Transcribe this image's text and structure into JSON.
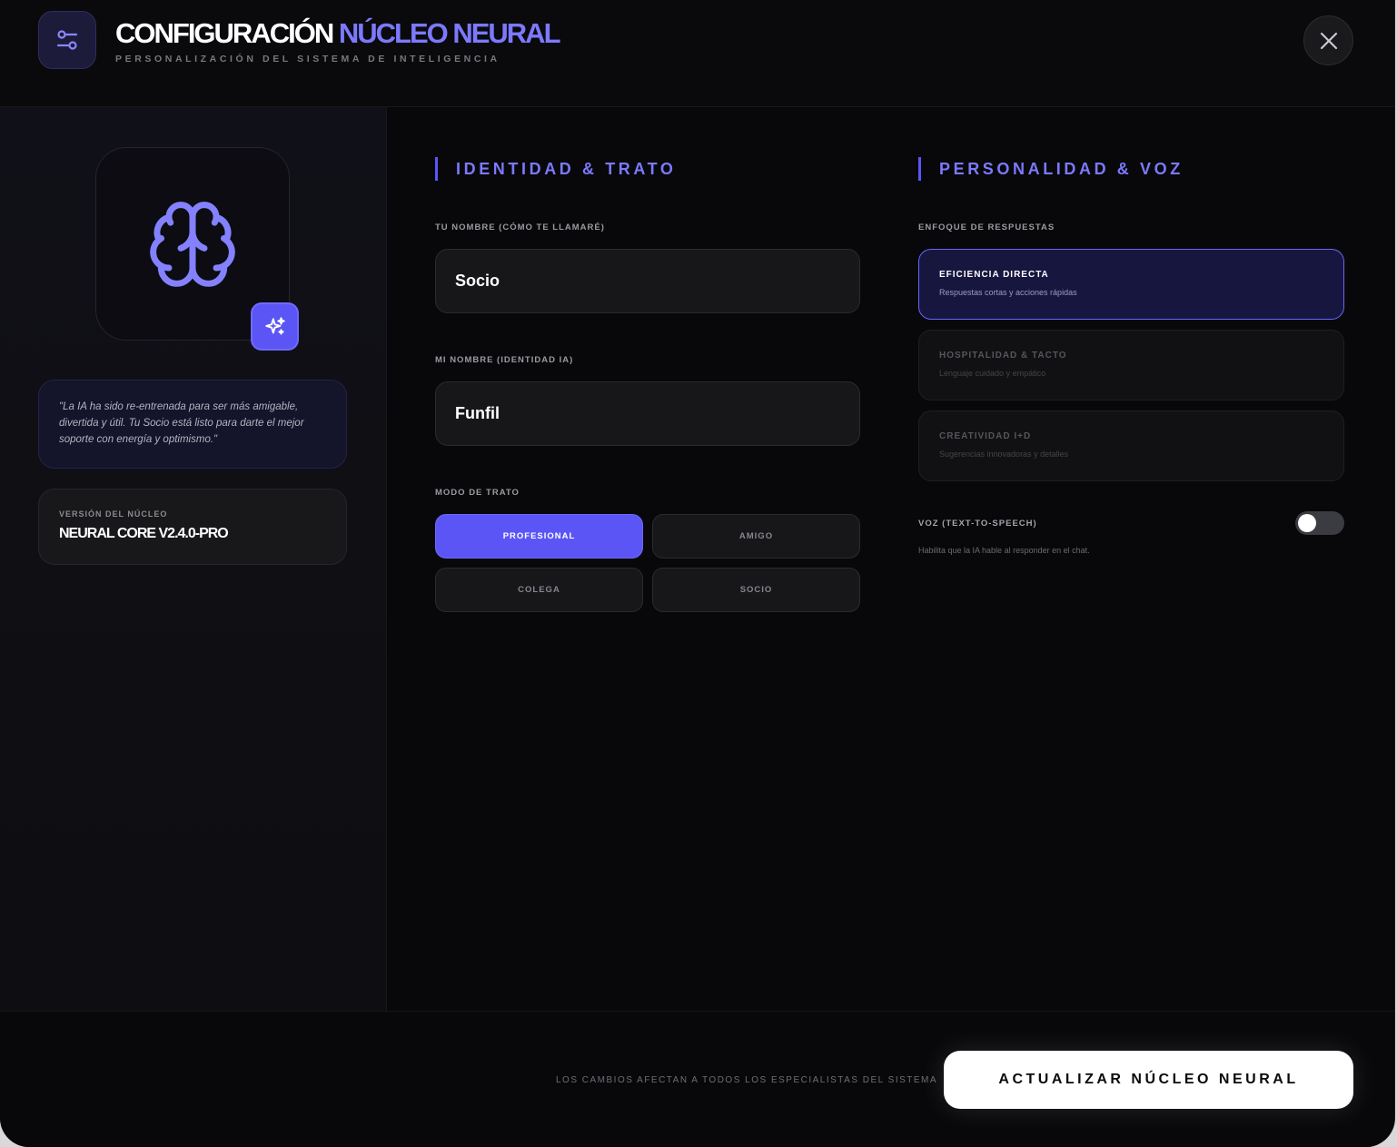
{
  "header": {
    "title_main": "CONFIGURACIÓN",
    "title_accent": "NÚCLEO NEURAL",
    "subtitle": "PERSONALIZACIÓN DEL SISTEMA DE INTELIGENCIA",
    "icon": "sliders-icon",
    "close_icon": "close-icon"
  },
  "sidebar": {
    "avatar_icon": "brain-icon",
    "sparkle_icon": "sparkles-icon",
    "quote": "\"La IA ha sido re-entrenada para ser más amigable, divertida y útil. Tu Socio está listo para darte el mejor soporte con energía y optimismo.\"",
    "version_label": "VERSIÓN DEL NÚCLEO",
    "version_value": "NEURAL CORE V2.4.0-PRO"
  },
  "identity": {
    "section_title": "IDENTIDAD & TRATO",
    "user_name_label": "TU NOMBRE (CÓMO TE LLAMARÉ)",
    "user_name_value": "Socio",
    "ai_name_label": "MI NOMBRE (IDENTIDAD IA)",
    "ai_name_value": "Funfil",
    "mode_label": "MODO DE TRATO",
    "modes": [
      {
        "label": "PROFESIONAL",
        "active": true
      },
      {
        "label": "AMIGO",
        "active": false
      },
      {
        "label": "COLEGA",
        "active": false
      },
      {
        "label": "SOCIO",
        "active": false
      }
    ]
  },
  "personality": {
    "section_title": "PERSONALIDAD & VOZ",
    "focus_label": "ENFOQUE DE RESPUESTAS",
    "focus_options": [
      {
        "title": "EFICIENCIA DIRECTA",
        "desc": "Respuestas cortas y acciones rápidas",
        "active": true
      },
      {
        "title": "HOSPITALIDAD & TACTO",
        "desc": "Lenguaje cuidado y empático",
        "active": false
      },
      {
        "title": "CREATIVIDAD I+D",
        "desc": "Sugerencias innovadoras y detalles",
        "active": false
      }
    ],
    "voice_label": "VOZ (TEXT-TO-SPEECH)",
    "voice_enabled": false,
    "voice_help": "Habilita que la IA hable al responder en el chat."
  },
  "footer": {
    "note": "LOS CAMBIOS AFECTAN A TODOS LOS ESPECIALISTAS DEL SISTEMA",
    "update_label": "ACTUALIZAR NÚCLEO NEURAL"
  },
  "colors": {
    "accent": "#5b55f6",
    "accent_text": "#7c79ff",
    "background": "#08080a"
  }
}
